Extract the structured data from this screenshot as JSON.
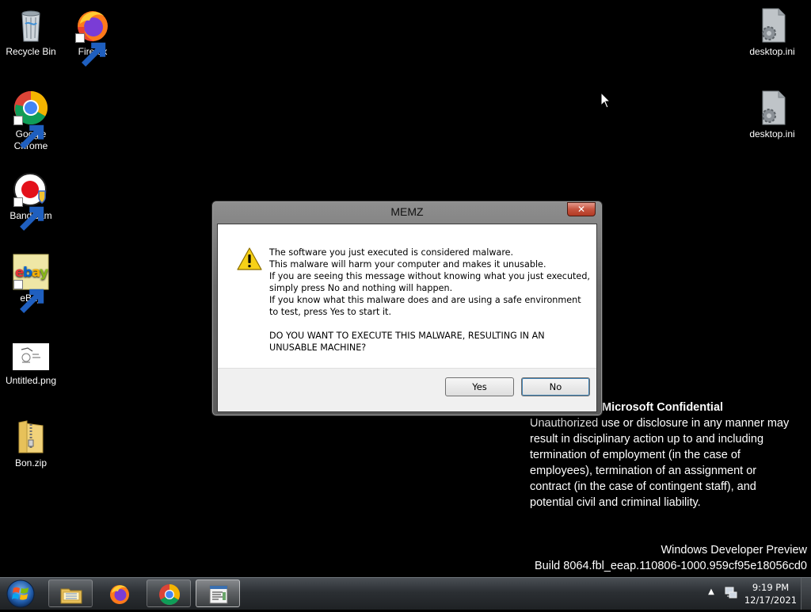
{
  "desktop": {
    "left_icons": [
      {
        "label": "Recycle Bin",
        "icon": "recycle-bin-icon"
      },
      {
        "label": "Firefox",
        "icon": "firefox-icon"
      },
      {
        "label": "Google Chrome",
        "icon": "chrome-icon"
      },
      {
        "label": "Bandicam",
        "icon": "bandicam-icon"
      },
      {
        "label": "eBay",
        "icon": "ebay-icon"
      },
      {
        "label": "Untitled.png",
        "icon": "image-file-icon"
      },
      {
        "label": "Bon.zip",
        "icon": "zip-folder-icon"
      }
    ],
    "right_icons": [
      {
        "label": "desktop.ini",
        "icon": "settings-file-icon"
      },
      {
        "label": "desktop.ini",
        "icon": "settings-file-icon"
      }
    ]
  },
  "watermark": {
    "title": "Microsoft Confidential",
    "body": "Unauthorized use or disclosure in any manner may\nresult in disciplinary action up to and including\ntermination of employment (in the case of\nemployees), termination of an assignment or\ncontract (in the case of contingent staff), and\npotential civil and criminal liability.",
    "product": "Windows Developer Preview",
    "build": "Build 8064.fbl_eeap.110806-1000.959cf95e18056cd0"
  },
  "dialog": {
    "title": "MEMZ",
    "close_glyph": "✕",
    "icon": "warning-icon",
    "lines": [
      "The software you just executed is considered malware.",
      "This malware will harm your computer and makes it unusable.",
      "If you are seeing this message without knowing what you just executed,",
      "simply press No and nothing will happen.",
      "If you know what this malware does and are using a safe environment",
      "to test, press Yes to start it."
    ],
    "question_lines": [
      "DO YOU WANT TO EXECUTE THIS MALWARE, RESULTING IN AN",
      "UNUSABLE MACHINE?"
    ],
    "yes_label": "Yes",
    "no_label": "No"
  },
  "taskbar": {
    "buttons": [
      {
        "icon": "explorer-icon",
        "state": "pinned"
      },
      {
        "icon": "firefox-icon",
        "state": "none"
      },
      {
        "icon": "chrome-icon",
        "state": "pinned"
      },
      {
        "icon": "app-window-icon",
        "state": "active"
      }
    ],
    "tray_arrow": "▲",
    "clock_time": "9:19 PM",
    "clock_date": "12/17/2021"
  }
}
